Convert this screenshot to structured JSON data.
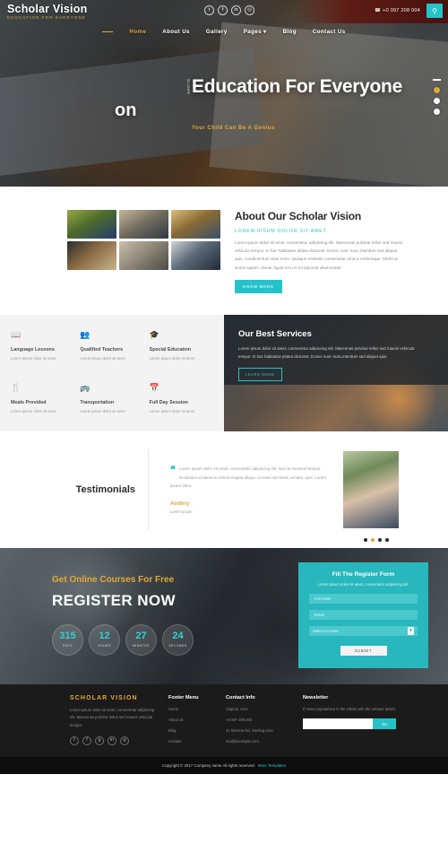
{
  "header": {
    "brand_name": "Scholar Vision",
    "brand_tagline": "EDUCATION FOR EVERYONE",
    "phone": "+0 097 208 004",
    "phone_icon": "phone-icon",
    "search_icon": "search-icon",
    "social": [
      {
        "name": "twitter-icon",
        "glyph": "t"
      },
      {
        "name": "facebook-icon",
        "glyph": "f"
      },
      {
        "name": "linkedin-icon",
        "glyph": "in"
      },
      {
        "name": "dribbble-icon",
        "glyph": "◎"
      }
    ],
    "nav": [
      {
        "label": "Home",
        "active": true
      },
      {
        "label": "About Us",
        "active": false
      },
      {
        "label": "Gallery",
        "active": false
      },
      {
        "label": "Pages ▾",
        "active": false
      },
      {
        "label": "Blog",
        "active": false
      },
      {
        "label": "Contact Us",
        "active": false
      }
    ]
  },
  "hero": {
    "ghost_text": "on",
    "vertical_text": "SLIDER",
    "title": "Education For Everyone",
    "subtitle": "Your Child Can Be A Genius",
    "dots": [
      "inactive",
      "active",
      "inactive"
    ]
  },
  "about": {
    "heading": "About Our Scholar Vision",
    "subheading": "LOREM IPSUM DOLOR SIT AMET",
    "body": "Lorem ipsum dolor sit amet, consectetur adipiscing elit. Maecenas pulvinar tellus sed mauris vehicula tempor. In hac habitasse platea dictumst. Donec nunc nunc,interdum sed aliquet quis, condimentum vitae enim. Quisque molestie consectetur urna a scelerisque. Morbi at lectus sapien. Donec ligula arcu in mi placerat ullamcorper.",
    "button": "KNOW MORE"
  },
  "features": [
    {
      "icon": "book-icon",
      "glyph": "📖",
      "title": "Language Lessons",
      "desc": "Lorem ipsum dolor sit amet"
    },
    {
      "icon": "teachers-icon",
      "glyph": "👥",
      "title": "Qualified Teachers",
      "desc": "Lorem ipsum dolor sit amet"
    },
    {
      "icon": "graduation-cap-icon",
      "glyph": "🎓",
      "title": "Special Education",
      "desc": "Lorem ipsum dolor sit amet"
    },
    {
      "icon": "cutlery-icon",
      "glyph": "🍴",
      "title": "Meals Provided",
      "desc": "Lorem ipsum dolor sit amet"
    },
    {
      "icon": "bus-icon",
      "glyph": "🚌",
      "title": "Transportation",
      "desc": "Lorem ipsum dolor sit amet"
    },
    {
      "icon": "calendar-icon",
      "glyph": "📅",
      "title": "Full Day Session",
      "desc": "Lorem ipsum dolor sit amet"
    }
  ],
  "services": {
    "heading": "Our Best Services",
    "body": "Lorem ipsum dolor sit amet, consectetur adipiscing elit. Maecenas pulvinar tellus sed mauris vehicula tempor. In hac habitasse platea dictumst. Donec nunc nunc,interdum sed aliquet quis.",
    "button": "LEARN MORE"
  },
  "testimonials": {
    "section_title": "Testimonials",
    "quote_icon": "quote-icon",
    "quote": "Lorem ipsum dolor sit amet, consectetur adipiscing elit, sed do eiusmod tempor incididunt ut labore et dolore magna aliqua. Ut enim ad minim veniam, quis. Lorem ipsum dolor.",
    "author": "Andery",
    "author_role": "Lorem Ipsum",
    "dots": [
      "inactive",
      "active",
      "inactive",
      "inactive"
    ]
  },
  "register": {
    "kicker_prefix": "Get Online ",
    "kicker_highlight": "Courses For Free",
    "title": "REGISTER NOW",
    "counters": [
      {
        "value": "315",
        "label": "DAYS"
      },
      {
        "value": "12",
        "label": "HOURS"
      },
      {
        "value": "27",
        "label": "MINUTES"
      },
      {
        "value": "24",
        "label": "SECONDS"
      }
    ],
    "form": {
      "title": "Fill The Register Form",
      "subtitle": "Lorem ipsum dolor sit amet, consectetur adipiscing elit.",
      "name_placeholder": "Full name",
      "email_placeholder": "Email",
      "course_selected": "Select a course",
      "course_options": [
        "Select a course"
      ],
      "submit": "SUBMIT"
    }
  },
  "footer": {
    "brand": "SCHOLAR VISION",
    "about": "Lorem ipsum dolor sit amet, consectetur adipiscing elit. Maecenas pulvinar tellus sed mauris vehicula tempor.",
    "social": [
      {
        "name": "twitter-icon",
        "glyph": "t"
      },
      {
        "name": "facebook-icon",
        "glyph": "f"
      },
      {
        "name": "google-plus-icon",
        "glyph": "g"
      },
      {
        "name": "linkedin-icon",
        "glyph": "in"
      },
      {
        "name": "dribbble-icon",
        "glyph": "◎"
      }
    ],
    "menu": {
      "title": "Footer Menu",
      "items": [
        "Home",
        "About us",
        "Blog",
        "Contact"
      ]
    },
    "contact": {
      "title": "Contact Info",
      "lines": [
        "Virginia, USA",
        "+0 097 208 004",
        "41 Monroe Rd, Sterling USA",
        "mail@example.com"
      ]
    },
    "newsletter": {
      "title": "Newsletter",
      "text": "If news popularised in the 1960s with the release ipsum.",
      "placeholder": "",
      "button": "Go"
    },
    "copyright_text": "Copyright © 2017 Company name All rights reserved.",
    "copyright_link": "More Templates"
  },
  "colors": {
    "accent_teal": "#25c3c9",
    "accent_gold": "#e0a93a",
    "footer_bg": "#1b1b1b",
    "copy_bg": "#0d0d0d"
  }
}
